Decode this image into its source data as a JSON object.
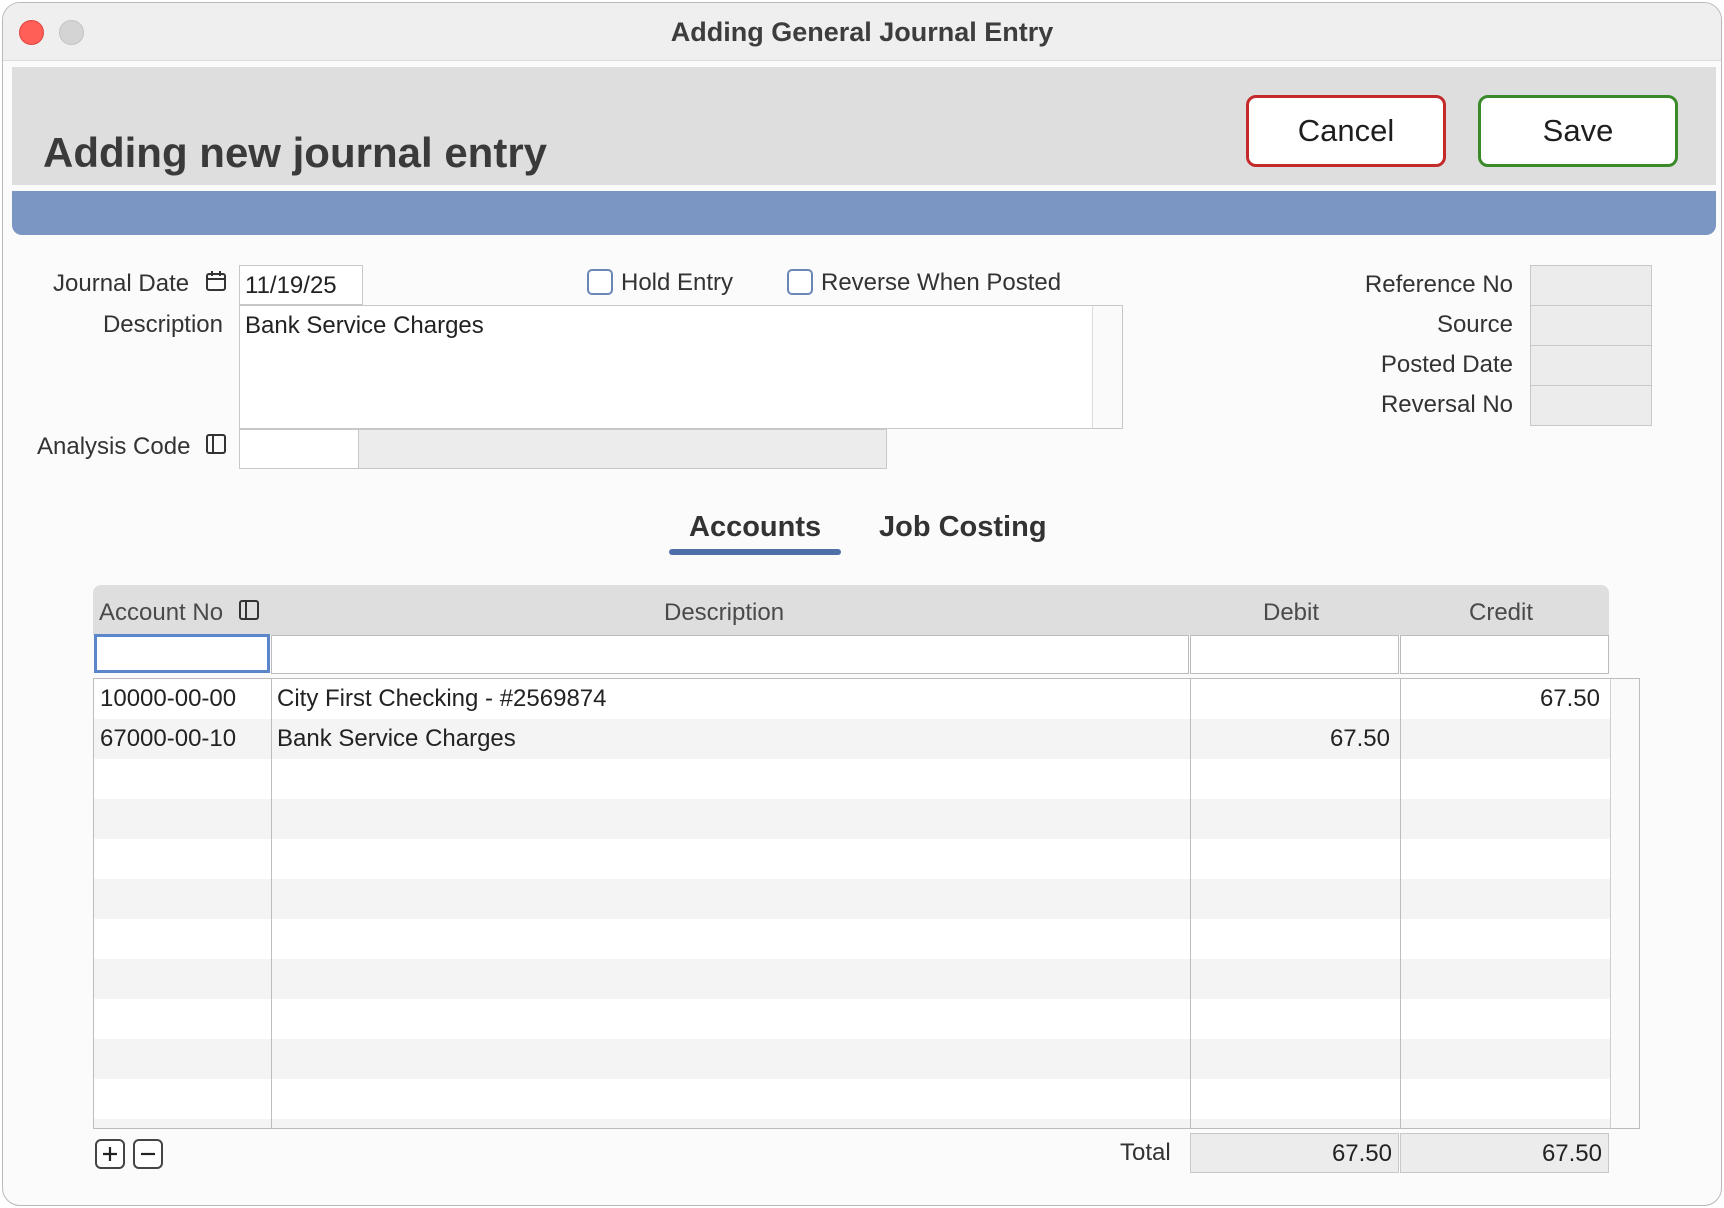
{
  "window": {
    "title": "Adding General Journal Entry"
  },
  "header": {
    "title": "Adding new journal entry",
    "cancel_label": "Cancel",
    "save_label": "Save"
  },
  "form": {
    "journal_date_label": "Journal Date",
    "journal_date_value": "11/19/25",
    "hold_entry_label": "Hold Entry",
    "hold_entry_checked": false,
    "reverse_when_posted_label": "Reverse When Posted",
    "reverse_when_posted_checked": false,
    "description_label": "Description",
    "description_value": "Bank Service Charges",
    "analysis_code_label": "Analysis Code",
    "analysis_code_value": "",
    "analysis_code_name": "",
    "reference_no_label": "Reference No",
    "source_label": "Source",
    "posted_date_label": "Posted Date",
    "reversal_no_label": "Reversal No",
    "reference_no_value": "",
    "source_value": "",
    "posted_date_value": "",
    "reversal_no_value": ""
  },
  "tabs": [
    {
      "label": "Accounts",
      "active": true
    },
    {
      "label": "Job Costing",
      "active": false
    }
  ],
  "grid": {
    "columns": [
      "Account No",
      "Description",
      "Debit",
      "Credit"
    ],
    "rows": [
      {
        "account": "10000-00-00",
        "description": "City First Checking - #2569874",
        "debit": "",
        "credit": "67.50"
      },
      {
        "account": "67000-00-10",
        "description": "Bank Service Charges",
        "debit": "67.50",
        "credit": ""
      }
    ],
    "total_label": "Total",
    "total_debit": "67.50",
    "total_credit": "67.50"
  },
  "icons": {
    "calendar": "calendar-icon",
    "lookup": "list-lookup-icon",
    "add": "plus-icon",
    "remove": "minus-icon"
  },
  "colors": {
    "accent_band": "#7b96c2",
    "cancel_border": "#c42a2a",
    "save_border": "#3a8a2a",
    "tab_underline": "#4f6fa8"
  }
}
